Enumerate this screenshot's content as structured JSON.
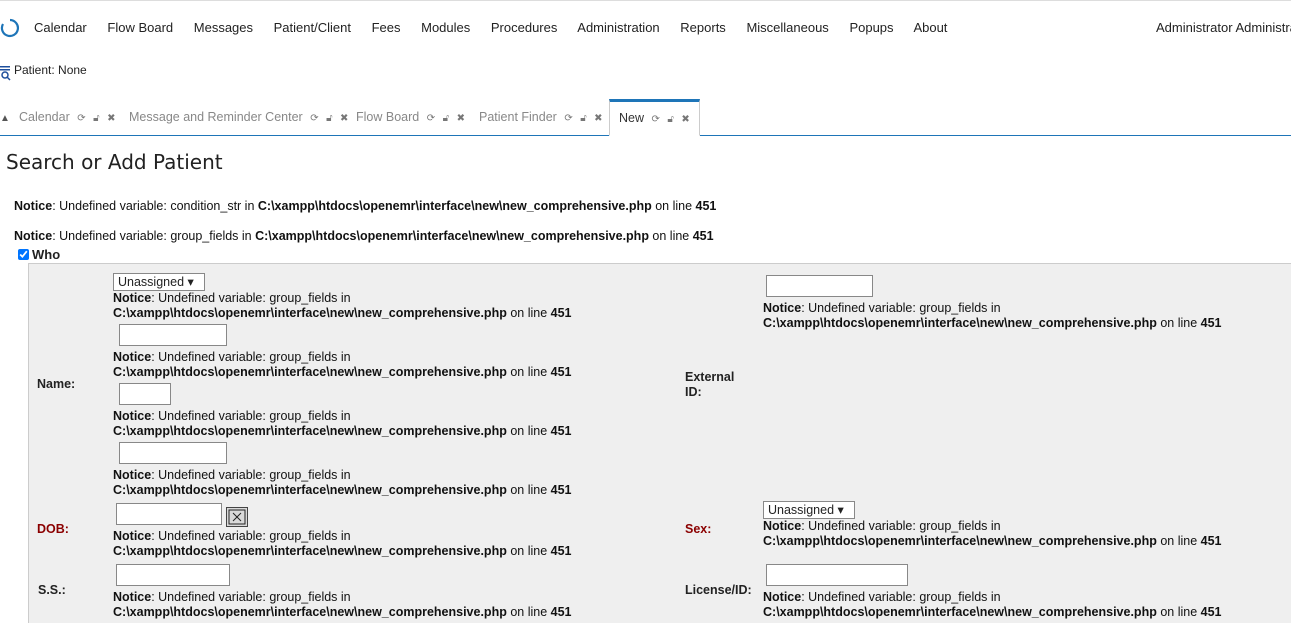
{
  "menu": {
    "items": [
      "Calendar",
      "Flow Board",
      "Messages",
      "Patient/Client",
      "Fees",
      "Modules",
      "Procedures",
      "Administration",
      "Reports",
      "Miscellaneous",
      "Popups",
      "About"
    ],
    "user": "Administrator Administrator"
  },
  "patient": {
    "label": "Patient: None"
  },
  "tabs": [
    {
      "label": "Calendar"
    },
    {
      "label": "Message and Reminder Center"
    },
    {
      "label": "Flow Board"
    },
    {
      "label": "Patient Finder"
    },
    {
      "label": "New"
    }
  ],
  "page": {
    "title": "Search or Add Patient"
  },
  "notice": {
    "prefix": "Notice",
    "cond_msg": ": Undefined variable: condition_str in ",
    "group_msg": ": Undefined variable: group_fields in ",
    "path": "C:\\xampp\\htdocs\\openemr\\interface\\new\\new_comprehensive.php",
    "on_line": " on line ",
    "line": "451"
  },
  "who": {
    "label": "Who",
    "checked": true
  },
  "form": {
    "name_label": "Name:",
    "external_id_label": "External ID:",
    "dob_label": "DOB:",
    "sex_label": "Sex:",
    "ss_label": "S.S.:",
    "license_label": "License/ID:",
    "title_select": "Unassigned",
    "sex_select": "Unassigned"
  },
  "colors": {
    "accent": "#1e75b8",
    "required": "#8b0000",
    "panel": "#efefef"
  }
}
